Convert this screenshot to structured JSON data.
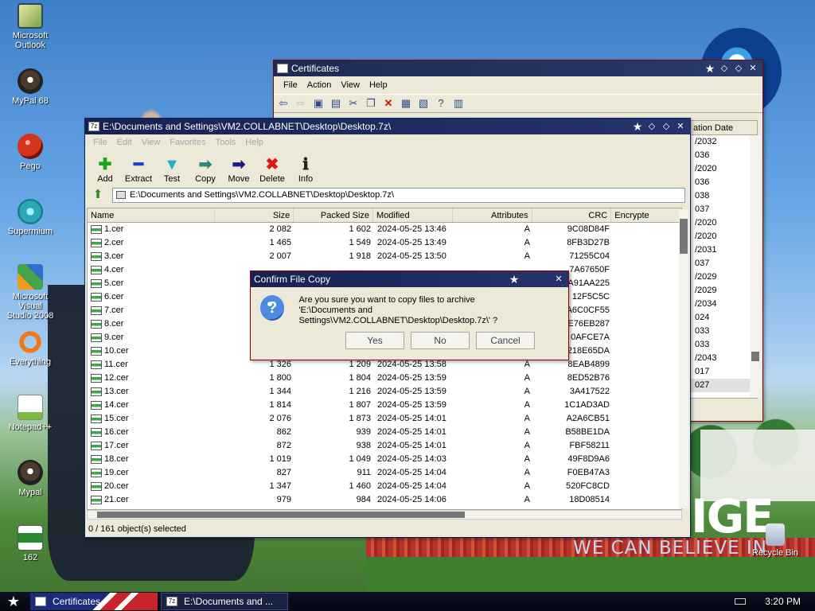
{
  "desktop": {
    "slogan_big": "IGE",
    "slogan": "WE CAN BELIEVE IN",
    "icons": [
      {
        "label": "Microsoft\nOutlook"
      },
      {
        "label": "MyPal 68"
      },
      {
        "label": "Pego"
      },
      {
        "label": "Supermium"
      },
      {
        "label": "Microsoft Visual\nStudio 2008"
      },
      {
        "label": "Everything"
      },
      {
        "label": "Notepad++"
      },
      {
        "label": "Mypal"
      },
      {
        "label": "162"
      },
      {
        "label": "Recycle Bin"
      }
    ]
  },
  "cert_window": {
    "title": "Certificates",
    "menu": [
      "File",
      "Action",
      "View",
      "Help"
    ],
    "column_header": "ation Date",
    "dates": [
      "/2032",
      "036",
      "/2020",
      "036",
      "038",
      "037",
      "/2020",
      "/2020",
      "/2031",
      "037",
      "/2029",
      "/2029",
      "/2034",
      "024",
      "033",
      "033",
      "/2043",
      "017",
      "027"
    ]
  },
  "zip_window": {
    "title": "E:\\Documents and Settings\\VM2.COLLABNET\\Desktop\\Desktop.7z\\",
    "menu": [
      "File",
      "Edit",
      "View",
      "Favorites",
      "Tools",
      "Help"
    ],
    "tools": [
      "Add",
      "Extract",
      "Test",
      "Copy",
      "Move",
      "Delete",
      "Info"
    ],
    "path": "E:\\Documents and Settings\\VM2.COLLABNET\\Desktop\\Desktop.7z\\",
    "columns": [
      "Name",
      "Size",
      "Packed Size",
      "Modified",
      "Attributes",
      "CRC",
      "Encrypte"
    ],
    "rows": [
      [
        "1.cer",
        "2 082",
        "1 602",
        "2024-05-25 13:46",
        "A",
        "9C08D84F"
      ],
      [
        "2.cer",
        "1 465",
        "1 549",
        "2024-05-25 13:49",
        "A",
        "8FB3D27B"
      ],
      [
        "3.cer",
        "2 007",
        "1 918",
        "2024-05-25 13:50",
        "A",
        "71255C04"
      ],
      [
        "4.cer",
        "",
        "",
        "",
        "",
        "7A67650F"
      ],
      [
        "5.cer",
        "",
        "",
        "",
        "",
        "A91AA225"
      ],
      [
        "6.cer",
        "",
        "",
        "",
        "",
        "12F5C5C"
      ],
      [
        "7.cer",
        "",
        "",
        "",
        "",
        "A6C0CF55"
      ],
      [
        "8.cer",
        "",
        "",
        "",
        "",
        "E76EB287"
      ],
      [
        "9.cer",
        "",
        "",
        "",
        "",
        "0AFCE7A"
      ],
      [
        "10.cer",
        "",
        "",
        "",
        "",
        "218E65DA"
      ],
      [
        "11.cer",
        "1 326",
        "1 209",
        "2024-05-25 13:58",
        "A",
        "8EAB4899"
      ],
      [
        "12.cer",
        "1 800",
        "1 804",
        "2024-05-25 13:59",
        "A",
        "8ED52B76"
      ],
      [
        "13.cer",
        "1 344",
        "1 216",
        "2024-05-25 13:59",
        "A",
        "3A417522"
      ],
      [
        "14.cer",
        "1 814",
        "1 807",
        "2024-05-25 13:59",
        "A",
        "1C1AD3AD"
      ],
      [
        "15.cer",
        "2 076",
        "1 873",
        "2024-05-25 14:01",
        "A",
        "A2A6CB51"
      ],
      [
        "16.cer",
        "862",
        "939",
        "2024-05-25 14:01",
        "A",
        "B58BE1DA"
      ],
      [
        "17.cer",
        "872",
        "938",
        "2024-05-25 14:01",
        "A",
        "FBF58211"
      ],
      [
        "18.cer",
        "1 019",
        "1 049",
        "2024-05-25 14:03",
        "A",
        "49F8D9A6"
      ],
      [
        "19.cer",
        "827",
        "911",
        "2024-05-25 14:04",
        "A",
        "F0EB47A3"
      ],
      [
        "20.cer",
        "1 347",
        "1 460",
        "2024-05-25 14:04",
        "A",
        "520FC8CD"
      ],
      [
        "21.cer",
        "979",
        "984",
        "2024-05-25 14:06",
        "A",
        "18D08514"
      ]
    ],
    "status": "0 / 161 object(s) selected"
  },
  "dialog": {
    "title": "Confirm File Copy",
    "line1": "Are you sure you want to copy files to archive",
    "line2": "'E:\\Documents and Settings\\VM2.COLLABNET\\Desktop\\Desktop.7z\\' ?",
    "yes": "Yes",
    "no": "No",
    "cancel": "Cancel"
  },
  "taskbar": {
    "items": [
      "Certificates",
      "E:\\Documents and ..."
    ],
    "zip_badge": "7z",
    "clock": "3:20 PM"
  }
}
